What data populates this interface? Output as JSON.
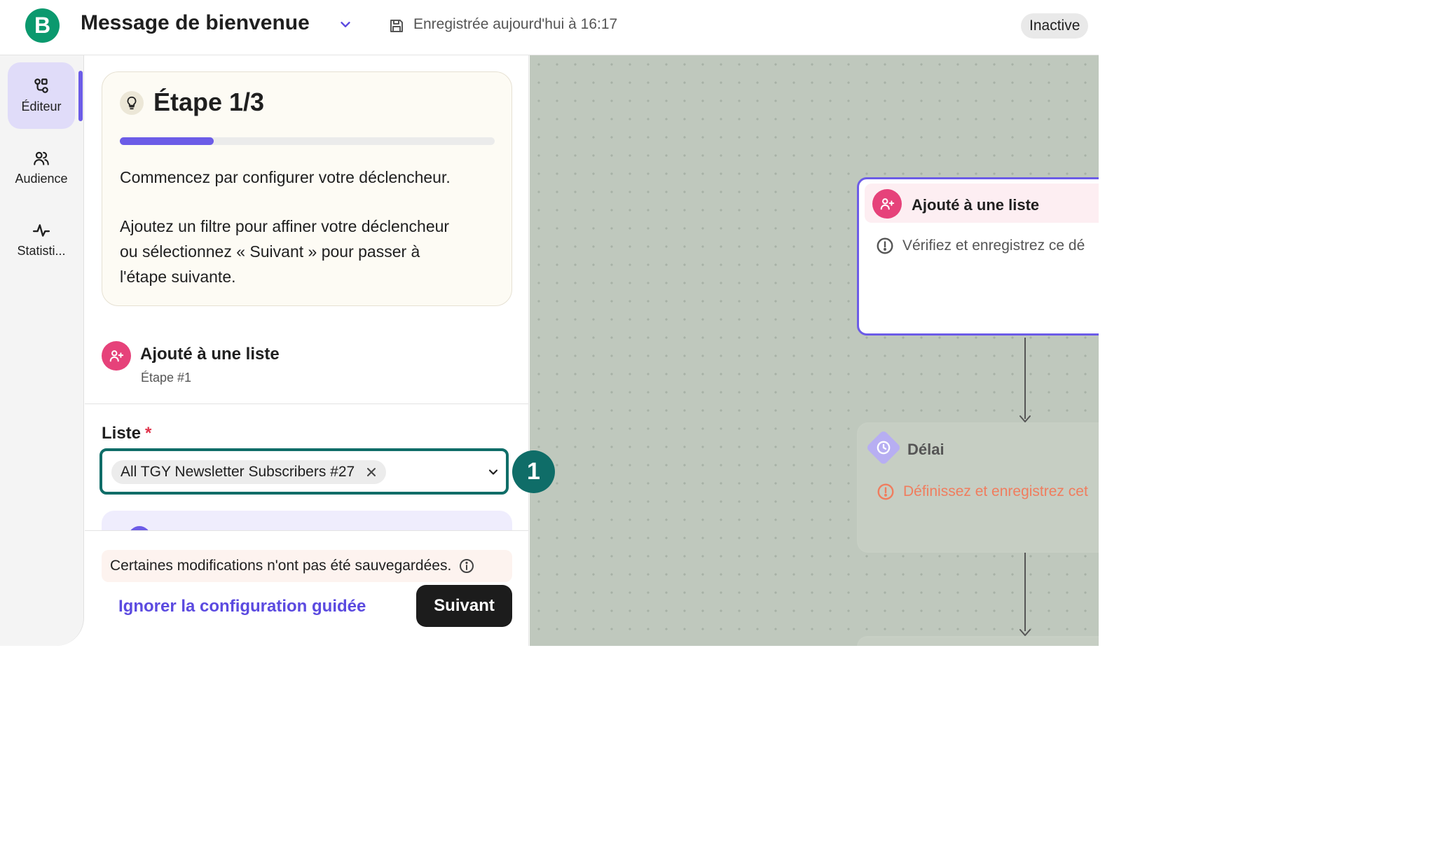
{
  "header": {
    "logo_letter": "B",
    "title": "Message de bienvenue",
    "saved_status": "Enregistrée aujourd'hui à 16:17",
    "status_badge": "Inactive"
  },
  "nav": {
    "items": [
      {
        "label": "Éditeur",
        "icon": "workflow-icon",
        "active": true
      },
      {
        "label": "Audience",
        "icon": "users-icon",
        "active": false
      },
      {
        "label": "Statisti...",
        "icon": "activity-icon",
        "active": false
      }
    ]
  },
  "guide": {
    "title": "Étape 1/3",
    "progress": 0.25,
    "text1": "Commencez par configurer votre déclencheur.",
    "text2": "Ajoutez un filtre pour affiner votre déclencheur ou sélectionnez « Suivant » pour passer à l'étape suivante."
  },
  "trigger": {
    "title": "Ajouté à une liste",
    "subtitle": "Étape #1"
  },
  "list_field": {
    "label": "Liste",
    "required_mark": "*",
    "selected_value": "All TGY Newsletter Subscribers #27"
  },
  "marker": {
    "label": "1"
  },
  "footer": {
    "unsaved_notice": "Certaines modifications n'ont pas été sauvegardées.",
    "skip_label": "Ignorer la configuration guidée",
    "next_label": "Suivant"
  },
  "canvas": {
    "node1": {
      "title": "Ajouté à une liste",
      "warning": "Vérifiez et enregistrez ce dé"
    },
    "node2": {
      "title": "Délai",
      "warning": "Définissez et enregistrez cet"
    }
  },
  "colors": {
    "brand": "#0b996e",
    "accent": "#6c5ce7",
    "trigger_pink": "#e6427a",
    "focus_teal": "#0f6d68",
    "warning_orange": "#f07d5e"
  }
}
